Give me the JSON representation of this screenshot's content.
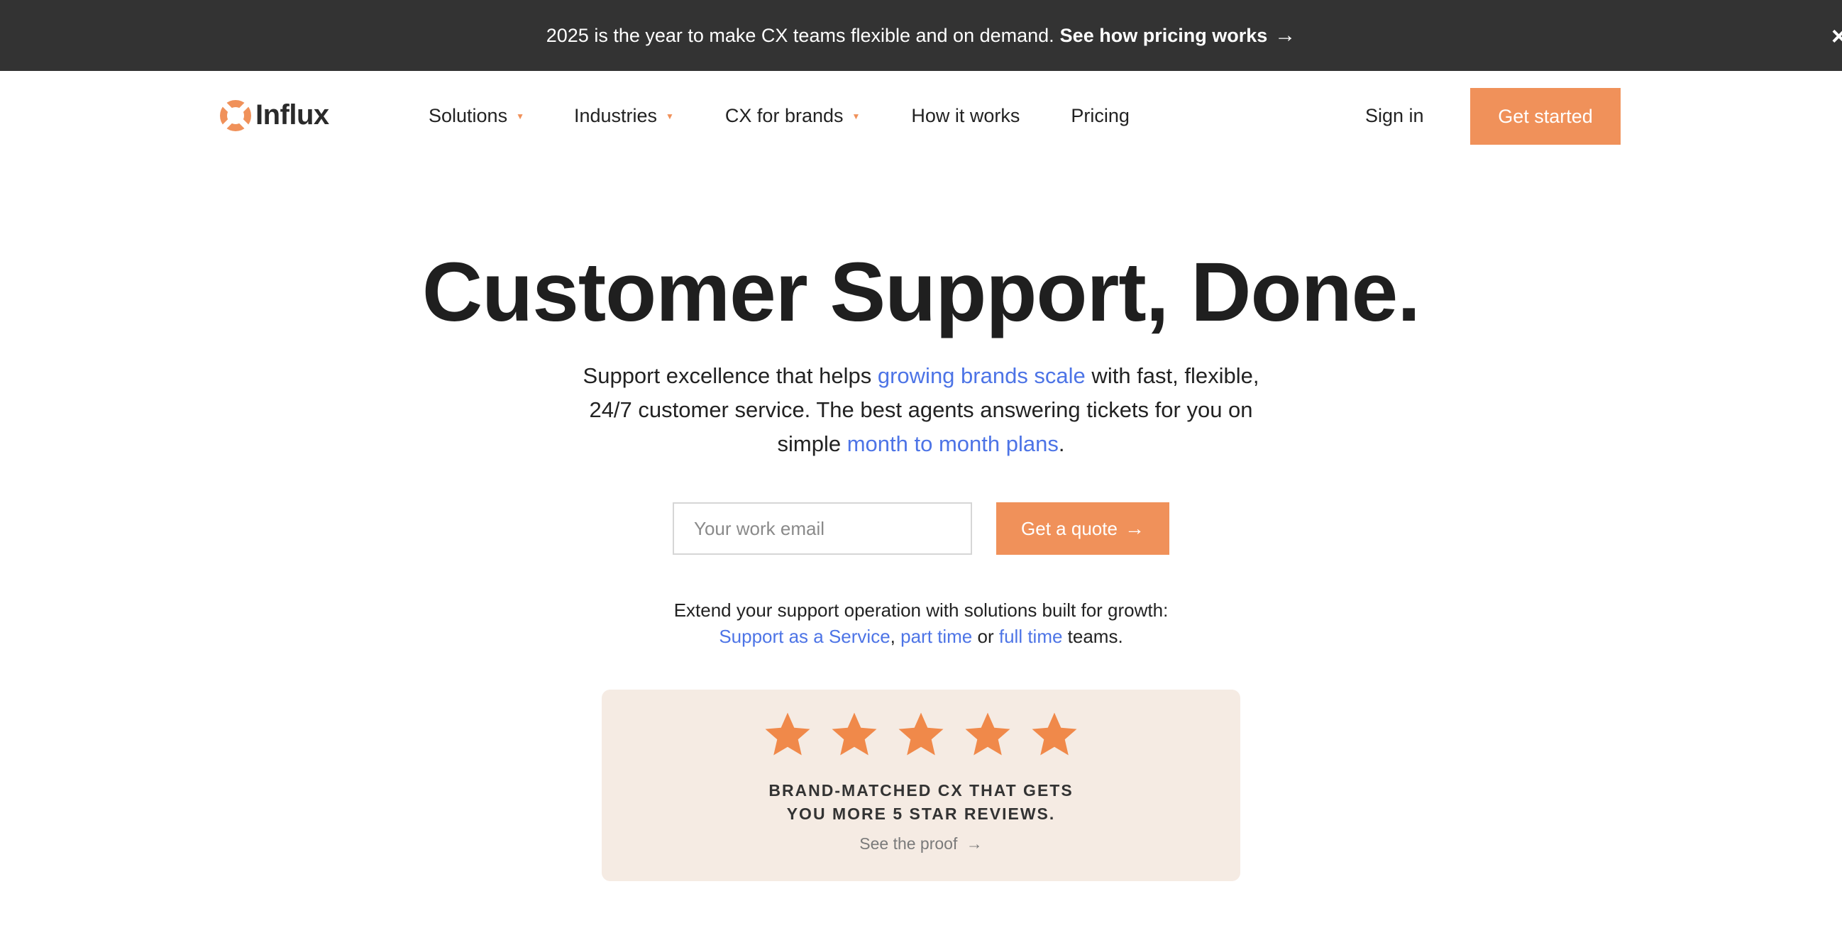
{
  "announcement": {
    "message": "2025 is the year to make CX teams flexible and on demand.",
    "link_label": "See how pricing works",
    "arrow": "→",
    "close": "×"
  },
  "brand": {
    "name": "Influx",
    "accent_color": "#f0915a",
    "link_color": "#4d74e6"
  },
  "nav": {
    "items": [
      {
        "label": "Solutions",
        "has_dropdown": true
      },
      {
        "label": "Industries",
        "has_dropdown": true
      },
      {
        "label": "CX for brands",
        "has_dropdown": true
      },
      {
        "label": "How it works",
        "has_dropdown": false
      },
      {
        "label": "Pricing",
        "has_dropdown": false
      }
    ],
    "caret": "▼",
    "sign_in": "Sign in",
    "get_started": "Get started"
  },
  "hero": {
    "title": "Customer Support, Done.",
    "sub_1": "Support excellence that helps ",
    "sub_link_1": "growing brands scale",
    "sub_2": " with fast, flexible, 24/7 customer service. The best agents answering tickets for you on simple ",
    "sub_link_2": "month to month plans",
    "sub_3": "."
  },
  "signup": {
    "email_placeholder": "Your work email",
    "quote_button": "Get a quote",
    "arrow": "→"
  },
  "extend": {
    "line_1": "Extend your support operation with solutions built for growth:",
    "link_1": "Support as a Service",
    "sep_1": ", ",
    "link_2": "part time",
    "sep_2": " or ",
    "link_3": "full time",
    "tail": " teams."
  },
  "review_card": {
    "stars": 5,
    "heading_line_1": "BRAND-MATCHED CX THAT GETS",
    "heading_line_2": "YOU MORE 5 STAR REVIEWS.",
    "proof_link": "See the proof",
    "arrow": "→",
    "background": "#f5ebe3"
  }
}
